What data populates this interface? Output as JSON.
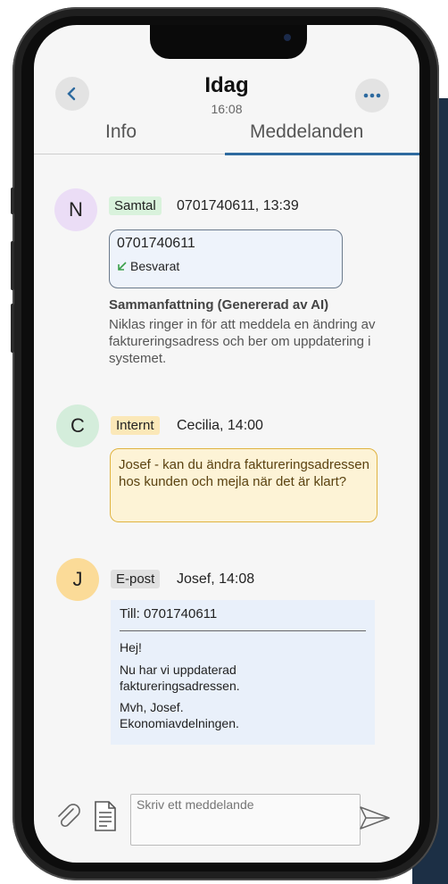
{
  "header": {
    "title": "Idag",
    "time": "16:08"
  },
  "tabs": [
    {
      "label": "Info"
    },
    {
      "label": "Meddelanden"
    }
  ],
  "messages": [
    {
      "initial": "N",
      "tag": "Samtal",
      "meta": "0701740611, 13:39",
      "call_number": "0701740611",
      "call_status": "Besvarat",
      "summary_title": "Sammanfattning (Genererad av AI)",
      "summary": "Niklas ringer in för att meddela en ändring av faktureringsadress och ber om uppdatering i systemet."
    },
    {
      "initial": "C",
      "tag": "Internt",
      "meta": "Cecilia, 14:00",
      "text": "Josef - kan du ändra faktureringsadressen hos kunden och mejla när det är klart?"
    },
    {
      "initial": "J",
      "tag": "E-post",
      "meta": "Josef, 14:08",
      "to": "Till: 0701740611",
      "lines": [
        "Hej!",
        "Nu har vi uppdaterad faktureringsadressen.",
        "Mvh, Josef. Ekonomiavdelningen."
      ]
    }
  ],
  "composer": {
    "placeholder": "Skriv ett meddelande"
  },
  "colors": {
    "accent": "#2d6a9f",
    "call_tag": "#d9f2dc",
    "internal_tag": "#fbe8b8",
    "email_tag": "#e0e0e0"
  }
}
